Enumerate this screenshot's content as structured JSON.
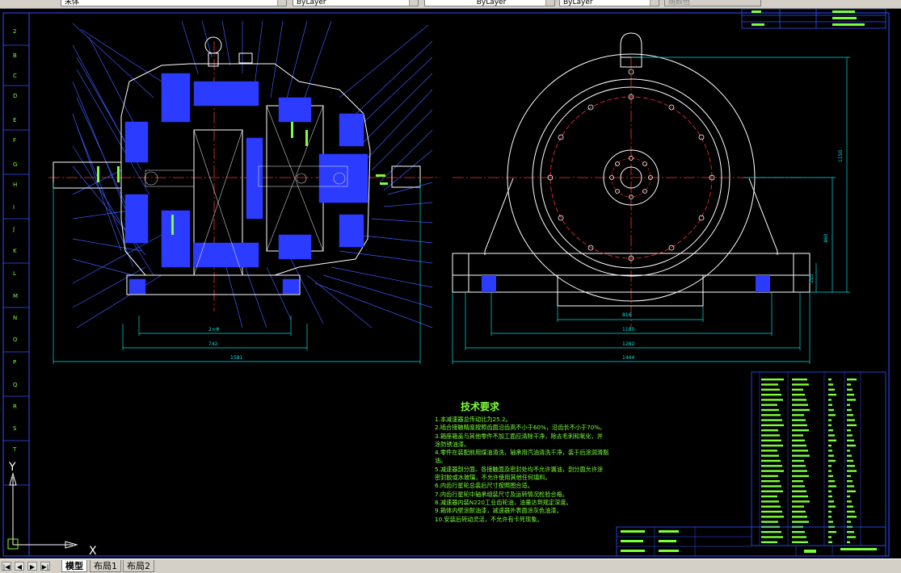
{
  "toolbar": {
    "text_style_value": "宋体",
    "layer_color_value": "ByLayer",
    "linetype_value": "ByLayer",
    "lineweight_value": "ByLayer",
    "plotstyle_value": "随颜色"
  },
  "tabs": {
    "model": "模型",
    "layout1": "布局1",
    "layout2": "布局2"
  },
  "nav": [
    "|◀",
    "◀",
    "▶",
    "▶|"
  ],
  "axes": {
    "x": "X",
    "y": "Y"
  },
  "tech_requirements": {
    "title": "技术要求",
    "items": [
      "1.本减速器总传动比为25.2。",
      "2.啮合接触精度按照齿面沿齿高不小于60%，沿齿长不小于70%。",
      "3.箱座箱盖与其他零件不加工面应清除干净，除去毛刺和氧化，并",
      "  涂防锈油漆。",
      "4.零件在装配前用煤油清洗，轴承用汽油清洗干净，装于后涂润滑脂",
      "  油。",
      "5.减速器剖分面、各接触面及密封处均不允许漏油，剖分面允许涂",
      "  密封胶或水玻璃，不允许使用其他任何填料。",
      "6.内齿行星轮总装后尺寸按照图合适。",
      "7.内齿行星轮中轴承组装尺寸及运转情况检验合格。",
      "8.减速器内装N220工业齿轮油，油量达到规定深度。",
      "9.箱体内壁涂耐油漆，减速器外表面涂灰色油漆。",
      "10.安装后转动灵活，不允许有卡死现象。"
    ]
  },
  "colors": {
    "background": "#000000",
    "outline": "#ffffff",
    "hatch": "#2b3bff",
    "leader": "#3b5bff",
    "center_line": "#ff3030",
    "dimension": "#00e0e0",
    "text_green": "#7cff3a",
    "frame": "#3050ff",
    "chrome": "#d4d0c8"
  }
}
